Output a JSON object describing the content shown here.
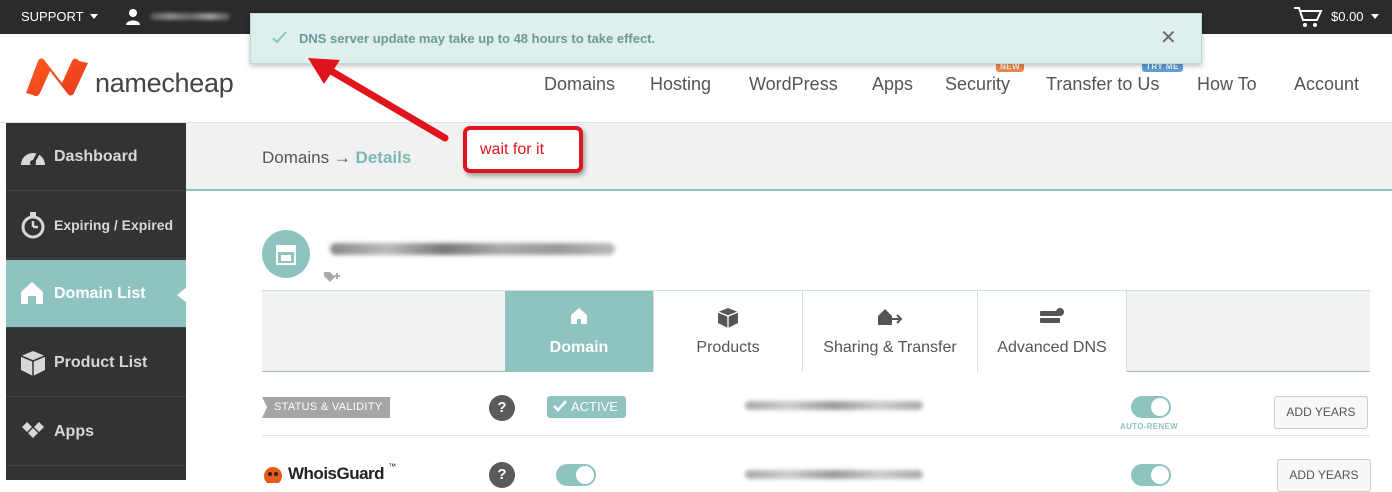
{
  "topbar": {
    "support_label": "SUPPORT",
    "cart_total": "$0.00"
  },
  "notification": {
    "message": "DNS server update may take up to 48 hours to take effect.",
    "close_glyph": "✕"
  },
  "header": {
    "brand": "namecheap",
    "nav": [
      {
        "label": "Domains"
      },
      {
        "label": "Hosting"
      },
      {
        "label": "WordPress"
      },
      {
        "label": "Apps"
      },
      {
        "label": "Security",
        "badge": "NEW"
      },
      {
        "label": "Transfer to Us",
        "badge": "TRY ME"
      },
      {
        "label": "How To"
      },
      {
        "label": "Account"
      }
    ],
    "badge_colors": {
      "new": "#f0874f",
      "tryme": "#5ea0d8"
    }
  },
  "sidebar": {
    "items": [
      {
        "label": "Dashboard",
        "icon": "gauge-icon"
      },
      {
        "label": "Expiring / Expired",
        "icon": "stopwatch-icon"
      },
      {
        "label": "Domain List",
        "icon": "home-icon"
      },
      {
        "label": "Product List",
        "icon": "box-icon"
      },
      {
        "label": "Apps",
        "icon": "diamonds-icon"
      }
    ]
  },
  "breadcrumb": {
    "root": "Domains",
    "separator": " → ",
    "current": "Details"
  },
  "annotation": {
    "text": "wait for it"
  },
  "tabs": [
    {
      "label": "Domain",
      "icon": "home-icon"
    },
    {
      "label": "Products",
      "icon": "box-icon"
    },
    {
      "label": "Sharing & Transfer",
      "icon": "share-house-icon"
    },
    {
      "label": "Advanced DNS",
      "icon": "server-icon"
    }
  ],
  "rows": {
    "status": {
      "label": "STATUS & VALIDITY",
      "help": "?",
      "badge": "ACTIVE",
      "auto_renew_label": "AUTO-RENEW",
      "button": "ADD YEARS"
    },
    "whoisguard": {
      "logo": "WhoisGuard",
      "trademark": "™",
      "help": "?",
      "button": "ADD YEARS"
    }
  },
  "colors": {
    "accent": "#8fc3c0",
    "topbar": "#2b2b2b",
    "sidebar": "#333333",
    "annotation": "#e0141c"
  }
}
